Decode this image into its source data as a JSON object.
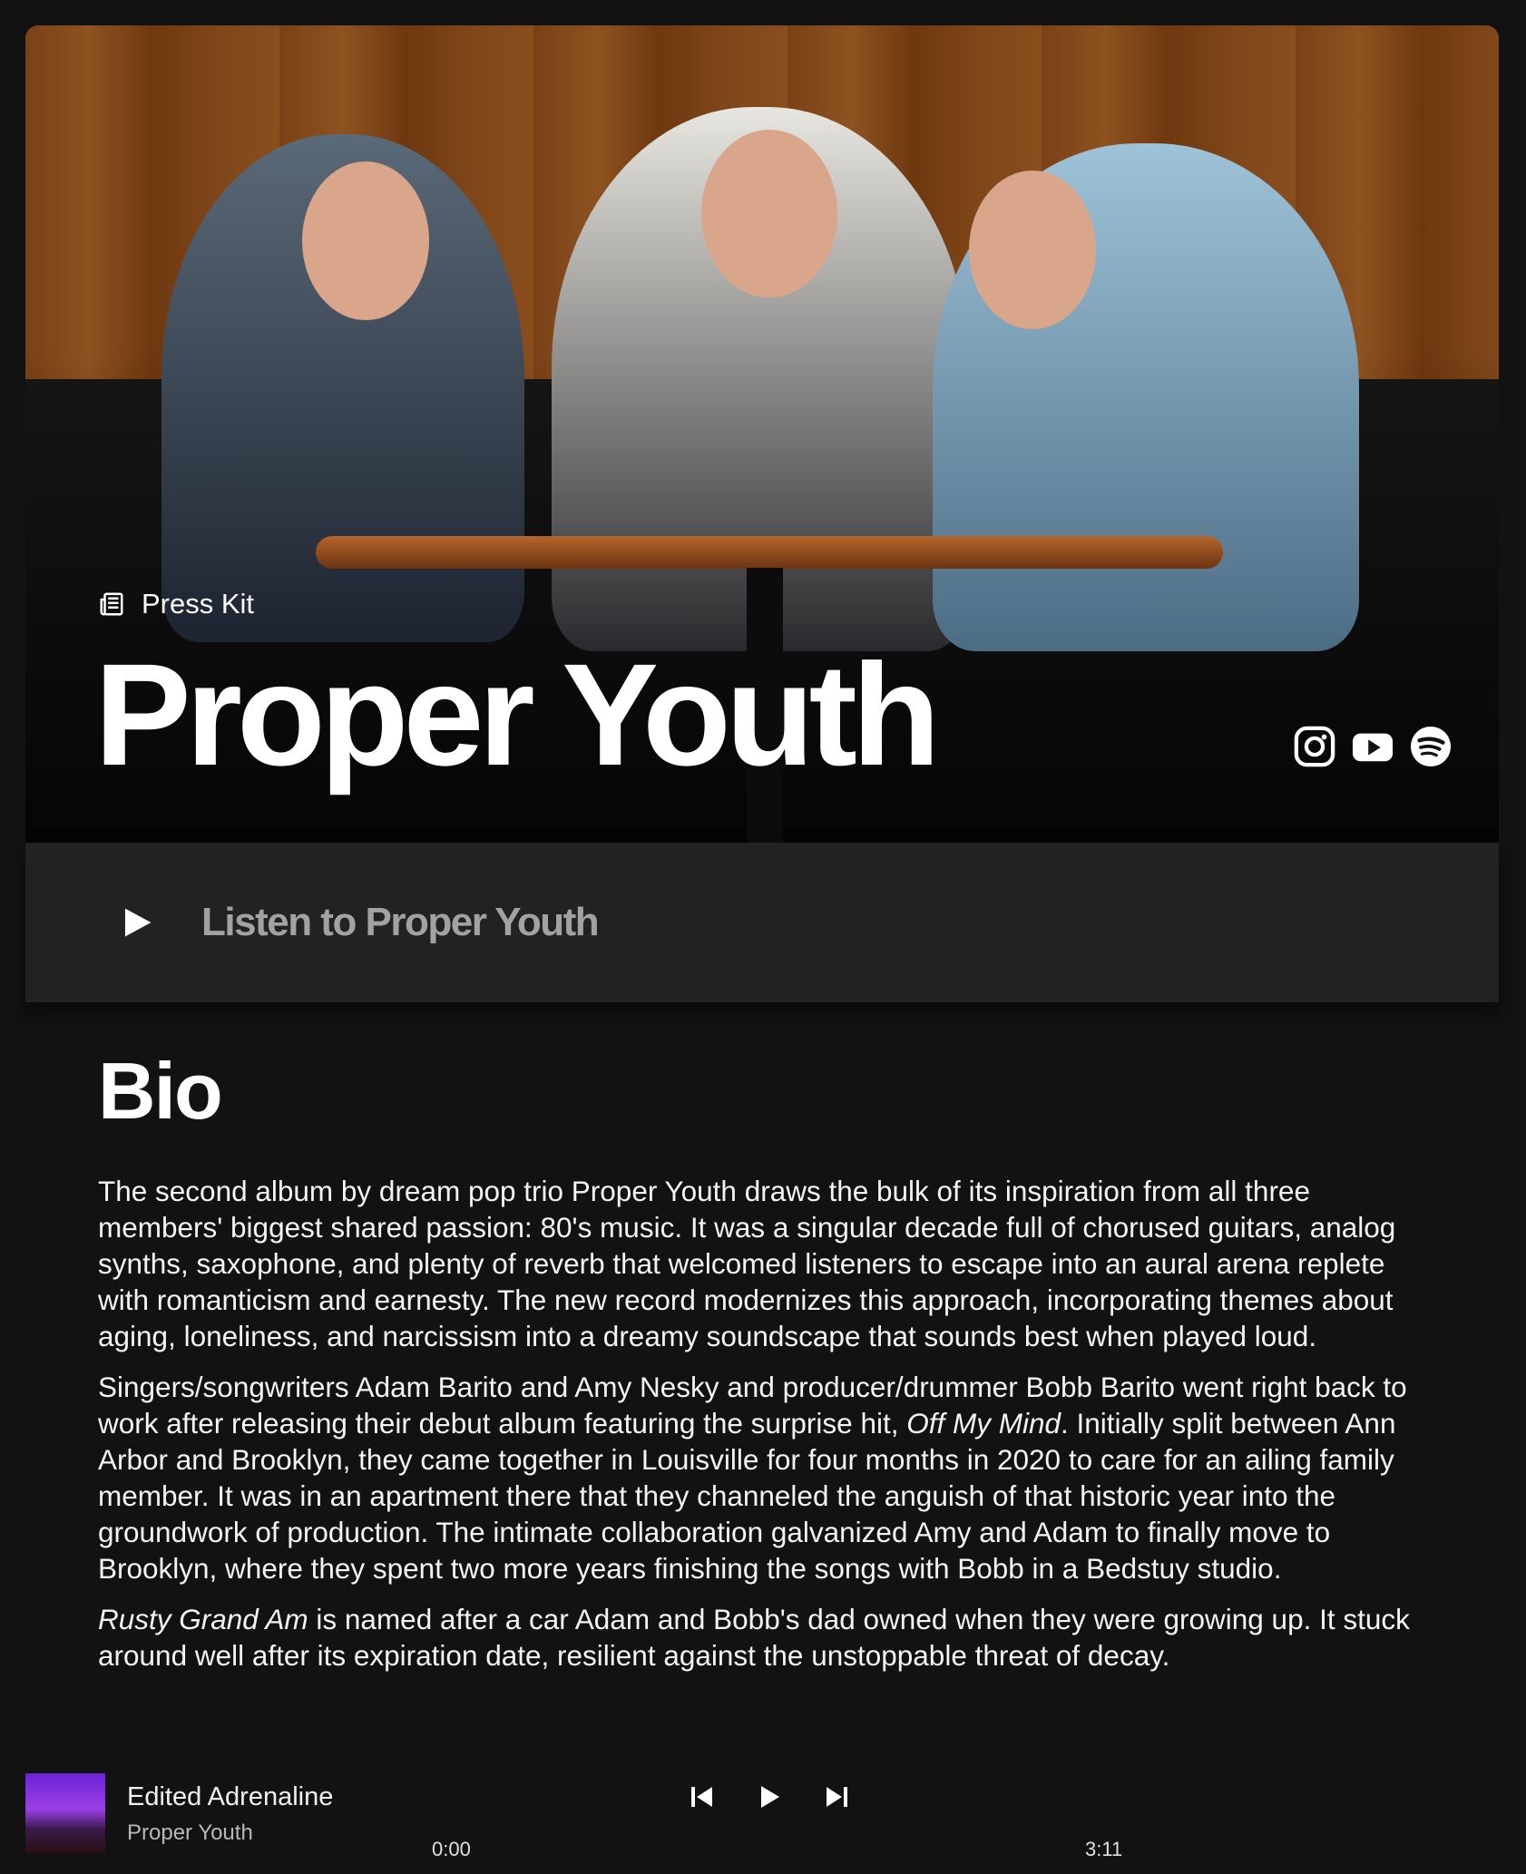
{
  "header": {
    "section_label": "Press Kit",
    "band_name": "Proper Youth",
    "socials": [
      "instagram-icon",
      "youtube-icon",
      "spotify-icon"
    ]
  },
  "listen": {
    "label": "Listen to Proper Youth",
    "icon": "play-icon"
  },
  "bio": {
    "title": "Bio",
    "p1": "The second album by dream pop trio Proper Youth draws the bulk of its inspiration from all three members' biggest shared passion: 80's music. It was a singular decade full of chorused guitars, analog synths, saxophone, and plenty of reverb that welcomed listeners to escape into an aural arena replete with romanticism and earnesty. The new record modernizes this approach, incorporating themes about aging, loneliness, and narcissism into a dreamy soundscape that sounds best when played loud.",
    "p2_a": "Singers/songwriters Adam Barito and Amy Nesky and producer/drummer Bobb Barito went right back to work after releasing their debut album featuring the surprise hit, ",
    "p2_em": "Off My Mind",
    "p2_b": ". Initially split between Ann Arbor and Brooklyn, they came together in Louisville for four months in 2020 to care for an ailing family member. It was in an apartment there that they channeled the anguish of that historic year into the groundwork of production. The intimate collaboration galvanized Amy and Adam to finally move to Brooklyn, where they spent two more years finishing the songs with Bobb in a Bedstuy studio.",
    "p3_em": "Rusty Grand Am",
    "p3_b": " is named after a car Adam and Bobb's dad owned when they were growing up. It stuck around well after its expiration date, resilient against the unstoppable threat of decay."
  },
  "player": {
    "track_title": "Edited Adrenaline",
    "track_artist": "Proper Youth",
    "time_current": "0:00",
    "time_total": "3:11"
  }
}
